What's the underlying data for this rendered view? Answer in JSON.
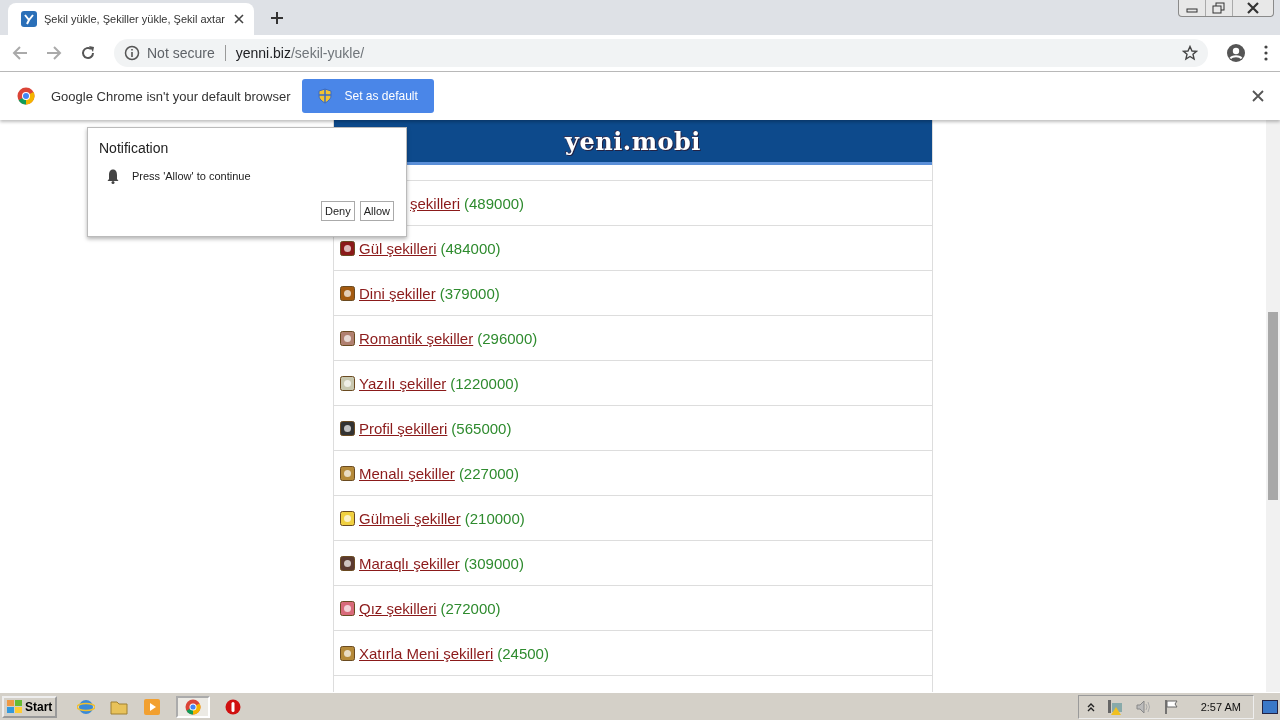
{
  "tab": {
    "title": "Şekil yükle, Şekiller yükle, Şekil axtar",
    "selected": true
  },
  "address_bar": {
    "security": "Not secure",
    "host": "yenni.biz",
    "path": "/sekil-yukle/"
  },
  "infobar": {
    "message": "Google Chrome isn't your default browser",
    "button": "Set as default"
  },
  "site": {
    "logo": "yeni.mobi"
  },
  "categories": [
    {
      "name": "şekilleri",
      "count": "(489000)"
    },
    {
      "name": "Gül şekilleri",
      "count": "(484000)"
    },
    {
      "name": "Dini şekiller",
      "count": "(379000)"
    },
    {
      "name": "Romantik şekiller",
      "count": "(296000)"
    },
    {
      "name": "Yazılı şekiller",
      "count": "(1220000)"
    },
    {
      "name": "Profil şekilleri",
      "count": "(565000)"
    },
    {
      "name": "Menalı şekiller",
      "count": "(227000)"
    },
    {
      "name": "Gülmeli şekiller",
      "count": "(210000)"
    },
    {
      "name": "Maraqlı şekiller",
      "count": "(309000)"
    },
    {
      "name": "Qız şekilleri",
      "count": "(272000)"
    },
    {
      "name": "Xatırla Meni şekilleri",
      "count": "(24500)"
    }
  ],
  "notification": {
    "title": "Notification",
    "message": "Press 'Allow' to continue",
    "buttons": [
      "Deny",
      "Allow"
    ]
  },
  "taskbar": {
    "start": "Start",
    "clock": "2:57 AM"
  }
}
